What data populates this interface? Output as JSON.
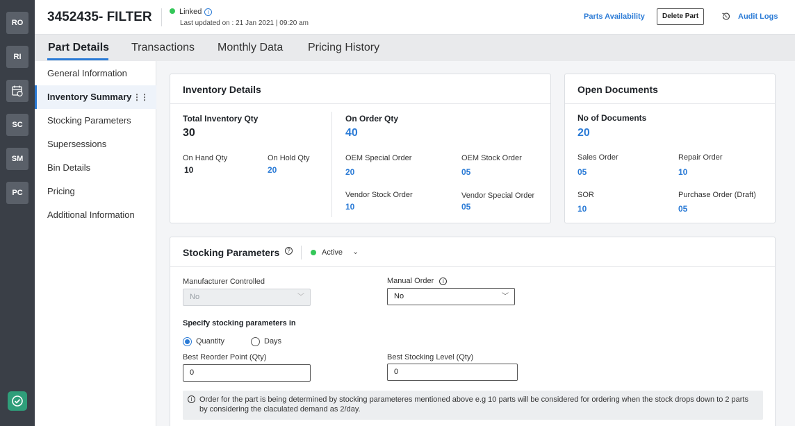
{
  "rail": {
    "items": [
      "RO",
      "RI",
      "",
      "SC",
      "SM",
      "PC"
    ]
  },
  "header": {
    "title": "3452435- FILTER",
    "linked": "Linked",
    "updated": "Last updated on : 21 Jan 2021 | 09:20 am",
    "parts_availability": "Parts Availability",
    "delete_part": "Delete Part",
    "audit_logs": "Audit Logs"
  },
  "tabs": [
    "Part Details",
    "Transactions",
    "Monthly Data",
    "Pricing History"
  ],
  "leftnav": [
    "General Information",
    "Inventory Summary",
    "Stocking Parameters",
    "Supersessions",
    "Bin Details",
    "Pricing",
    "Additional Information"
  ],
  "inventory": {
    "title": "Inventory Details",
    "total_label": "Total Inventory Qty",
    "total_value": "30",
    "on_hand_label": "On Hand Qty",
    "on_hand_value": "10",
    "on_hold_label": "On Hold Qty",
    "on_hold_value": "20",
    "on_order_label": "On Order Qty",
    "on_order_value": "40",
    "oem_special_label": "OEM Special Order",
    "oem_special_value": "20",
    "oem_stock_label": "OEM Stock Order",
    "oem_stock_value": "05",
    "vendor_stock_label": "Vendor Stock Order",
    "vendor_stock_value": "10",
    "vendor_special_label": "Vendor Special Order",
    "vendor_special_value": "05"
  },
  "open_docs": {
    "title": "Open Documents",
    "count_label": "No of Documents",
    "count_value": "20",
    "sales_label": "Sales Order",
    "sales_value": "05",
    "repair_label": "Repair Order",
    "repair_value": "10",
    "sor_label": "SOR",
    "sor_value": "10",
    "po_label": "Purchase Order (Draft)",
    "po_value": "05"
  },
  "stocking": {
    "title": "Stocking Parameters",
    "status": "Active",
    "mfr_label": "Manufacturer Controlled",
    "mfr_value": "No",
    "manual_label": "Manual Order",
    "manual_value": "No",
    "specify_label": "Specify stocking parameters in",
    "opt_quantity": "Quantity",
    "opt_days": "Days",
    "reorder_label": "Best Reorder Point (Qty)",
    "reorder_value": "0",
    "level_label": "Best Stocking Level (Qty)",
    "level_value": "0",
    "note": "Order for the part is being determined by stocking parameteres mentioned above e.g 10 parts will be considered for ordering when the stock drops down to 2 parts by considering the claculated demand as 2/day."
  },
  "colors": {
    "accent": "#2b7bd6",
    "active": "#34c759",
    "rail": "#3a3f47"
  }
}
